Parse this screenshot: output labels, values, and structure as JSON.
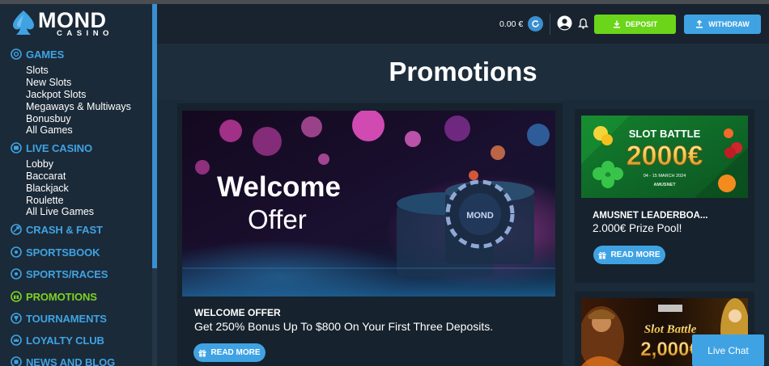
{
  "brand": {
    "name": "MOND",
    "sub": "CASINO",
    "accent": "#3fa3e3",
    "success": "#6bd51a"
  },
  "sidebar": {
    "sections": [
      {
        "label": "GAMES",
        "icon": "dice-icon",
        "items": [
          "Slots",
          "New Slots",
          "Jackpot Slots",
          "Megaways & Multiways",
          "Bonusbuy",
          "All Games"
        ]
      },
      {
        "label": "LIVE CASINO",
        "icon": "live-icon",
        "items": [
          "Lobby",
          "Baccarat",
          "Blackjack",
          "Roulette",
          "All Live Games"
        ]
      },
      {
        "label": "CRASH & FAST",
        "icon": "rocket-icon",
        "items": []
      },
      {
        "label": "SPORTSBOOK",
        "icon": "ball-icon",
        "items": []
      },
      {
        "label": "SPORTS/RACES",
        "icon": "ball-icon",
        "items": []
      },
      {
        "label": "PROMOTIONS",
        "icon": "gift-icon",
        "items": [],
        "active": true
      },
      {
        "label": "TOURNAMENTS",
        "icon": "trophy-icon",
        "items": []
      },
      {
        "label": "LOYALTY CLUB",
        "icon": "crown-icon",
        "items": []
      },
      {
        "label": "NEWS AND BLOG",
        "icon": "news-icon",
        "items": []
      }
    ]
  },
  "header": {
    "balance": "0.00 €",
    "deposit_label": "DEPOSIT",
    "withdraw_label": "WITHDRAW"
  },
  "page": {
    "title": "Promotions"
  },
  "promos": {
    "main": {
      "hero_line1": "Welcome",
      "hero_line2": "Offer",
      "chip_text": "MOND",
      "title": "WELCOME OFFER",
      "description": "Get 250% Bonus Up To $800 On Your First Three Deposits.",
      "button": "READ MORE"
    },
    "side1": {
      "banner_top": "SLOT BATTLE",
      "banner_amount": "2000€",
      "banner_dates": "04 - 15 MARCH 2024",
      "banner_brand": "AMUSNET",
      "title": "AMUSNET LEADERBOA...",
      "description": "2.000€ Prize Pool!",
      "button": "READ MORE"
    },
    "side2": {
      "banner_top": "Slot Battle",
      "banner_amount": "2,000€"
    }
  },
  "livechat": {
    "label": "Live Chat"
  }
}
